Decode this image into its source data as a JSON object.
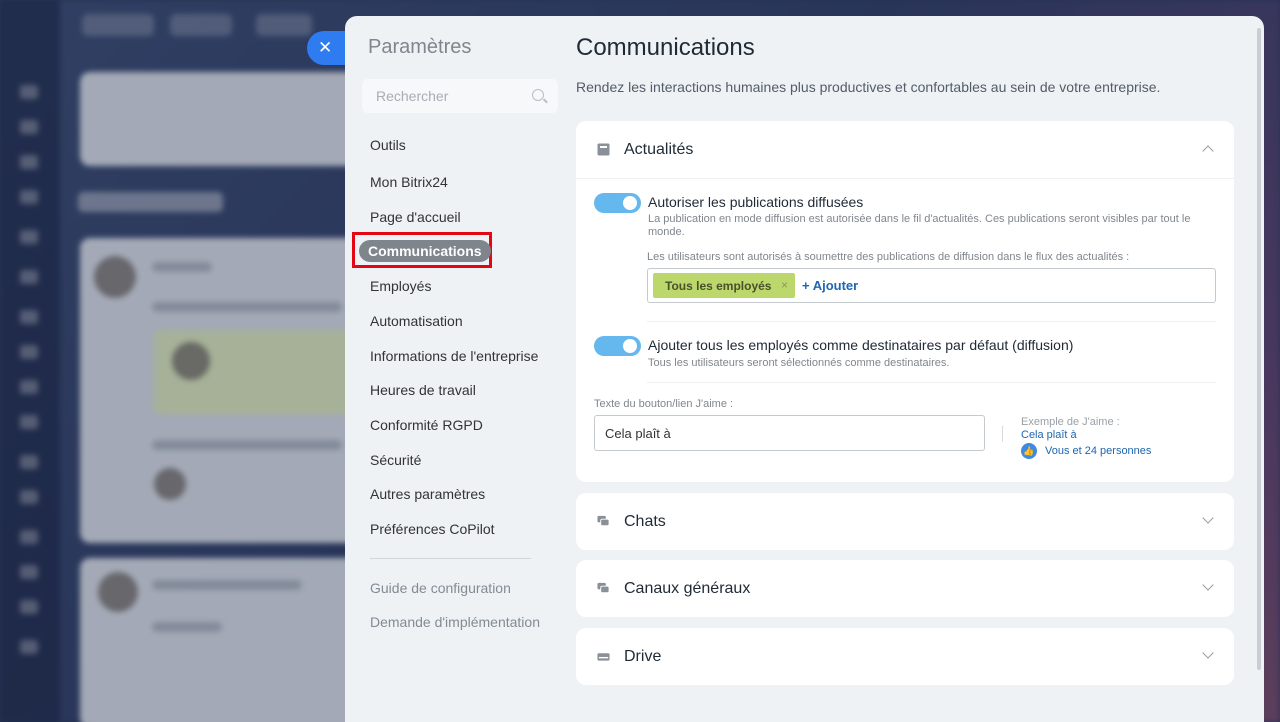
{
  "settings_panel": {
    "title": "Paramètres",
    "search_placeholder": "Rechercher",
    "nav_items": [
      {
        "label": "Outils"
      },
      {
        "label": "Mon Bitrix24"
      },
      {
        "label": "Page d'accueil"
      },
      {
        "label": "Communications",
        "active": true
      },
      {
        "label": "Employés"
      },
      {
        "label": "Automatisation"
      },
      {
        "label": "Informations de l'entreprise"
      },
      {
        "label": "Heures de travail"
      },
      {
        "label": "Conformité RGPD"
      },
      {
        "label": "Sécurité"
      },
      {
        "label": "Autres paramètres"
      },
      {
        "label": "Préférences CoPilot"
      }
    ],
    "nav_secondary": [
      {
        "label": "Guide de configuration"
      },
      {
        "label": "Demande d'implémentation"
      }
    ]
  },
  "main": {
    "title": "Communications",
    "description": "Rendez les interactions humaines plus productives et confortables au sein de votre entreprise.",
    "sections": {
      "news": {
        "title": "Actualités",
        "expanded": true,
        "option1": {
          "label": "Autoriser les publications diffusées",
          "desc": "La publication en mode diffusion est autorisée dans le fil d'actualités. Ces publications seront visibles par tout le monde.",
          "enabled": true
        },
        "allowed_label": "Les utilisateurs sont autorisés à soumettre des publications de diffusion dans le flux des actualités :",
        "tag": "Tous les employés",
        "tag_remove": "×",
        "add_label": "+ Ajouter",
        "option2": {
          "label": "Ajouter tous les employés comme destinataires par défaut (diffusion)",
          "desc": "Tous les utilisateurs seront sélectionnés comme destinataires.",
          "enabled": true
        },
        "like_field_label": "Texte du bouton/lien J'aime :",
        "like_field_value": "Cela plaît à",
        "example_label": "Exemple de J'aime :",
        "example_link": "Cela plaît à",
        "example_count": "Vous et 24 personnes"
      },
      "chats": {
        "title": "Chats"
      },
      "channels": {
        "title": "Canaux généraux"
      },
      "drive": {
        "title": "Drive"
      }
    }
  },
  "colors": {
    "accent": "#2f7bf0",
    "toggle_on": "#65b8ee",
    "tag_bg": "#bcd86c",
    "highlight": "#e30613"
  },
  "icons": {
    "close": "close-icon",
    "search": "search-icon",
    "news": "newspaper-icon",
    "chats": "chat-bubbles-icon",
    "channels": "chat-bubbles-icon",
    "drive": "drive-icon",
    "like": "thumbs-up-icon"
  }
}
